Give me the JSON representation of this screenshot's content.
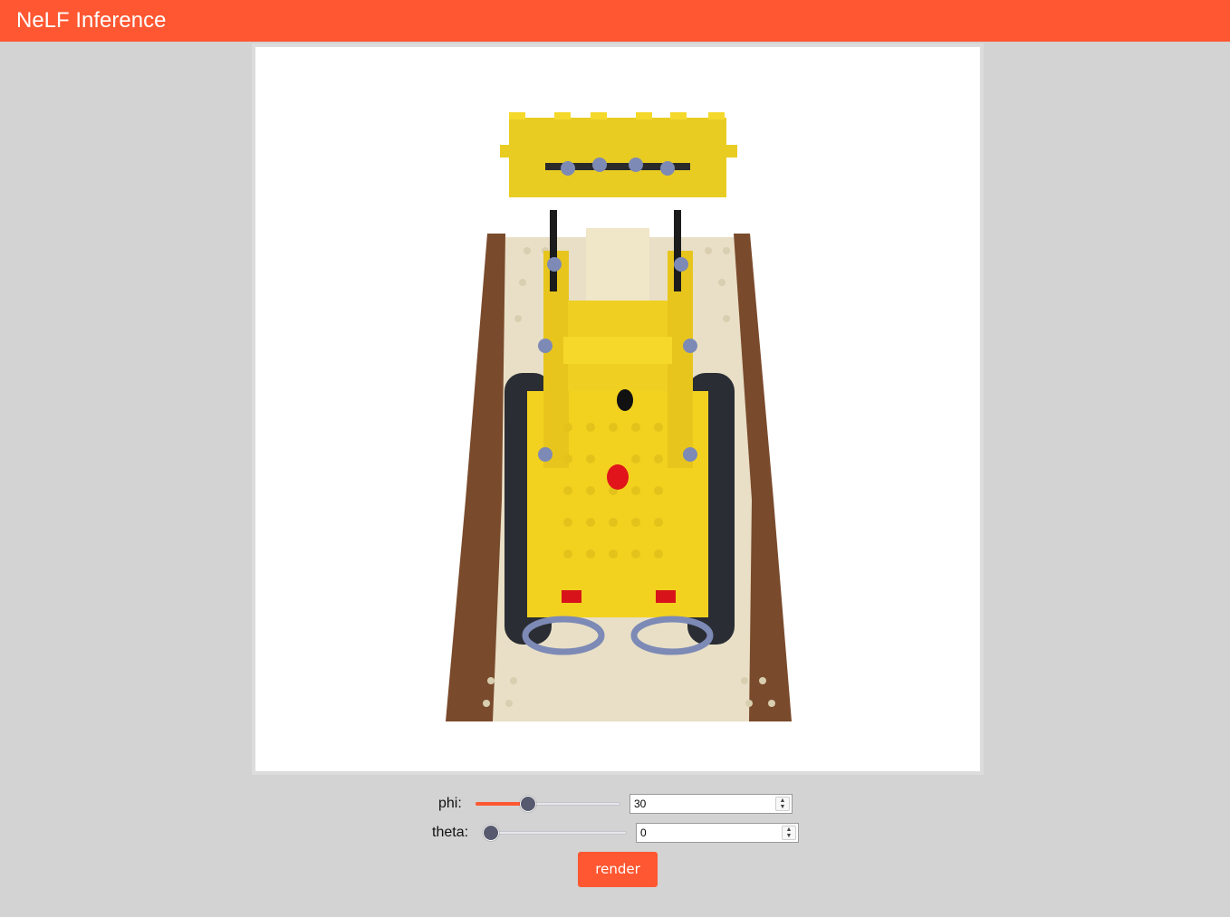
{
  "app": {
    "title": "NeLF Inference"
  },
  "controls": {
    "phi": {
      "label": "phi:",
      "value": "30",
      "slider_fraction": 0.36
    },
    "theta": {
      "label": "theta:",
      "value": "0",
      "slider_fraction": 0.0
    },
    "render_button": "render"
  },
  "colors": {
    "accent": "#fe5731",
    "background": "#d3d3d3",
    "slider_thumb": "#575a6e"
  },
  "icons": {
    "spinner": "up-down-spinner-icon"
  }
}
